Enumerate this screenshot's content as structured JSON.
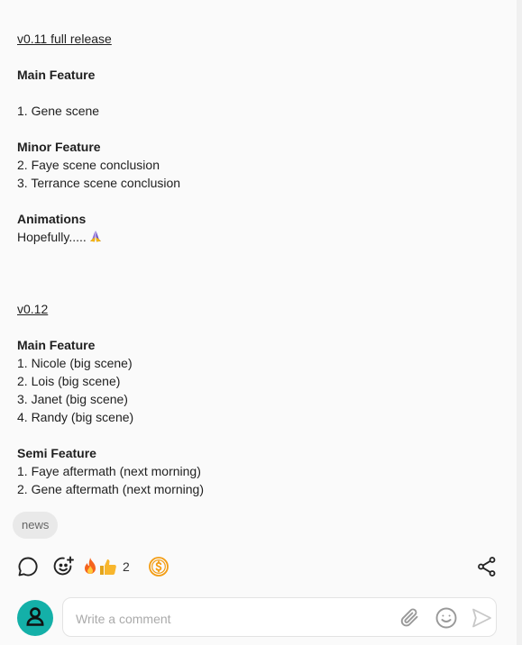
{
  "post": {
    "v011_link": "v0.11 full release",
    "v011_main_heading": "Main Feature",
    "v011_main_items": [
      "1. Gene scene"
    ],
    "v011_minor_heading": "Minor Feature",
    "v011_minor_items": [
      "2. Faye scene conclusion",
      "3. Terrance scene conclusion"
    ],
    "animations_heading": "Animations",
    "animations_text": "Hopefully.....",
    "v012_link": "v0.12",
    "v012_main_heading": "Main Feature",
    "v012_main_items": [
      "1. Nicole (big scene)",
      "2. Lois (big scene)",
      "3. Janet (big scene)",
      "4. Randy (big scene)"
    ],
    "v012_semi_heading": "Semi Feature",
    "v012_semi_items": [
      "1. Faye aftermath (next morning)",
      "2. Gene aftermath (next morning)"
    ]
  },
  "tags": [
    "news"
  ],
  "reactions": {
    "count": "2",
    "icons": [
      "comment-icon",
      "add-reaction-icon",
      "fire-emoji",
      "thumbs-up-emoji",
      "tip-coin-icon",
      "share-icon"
    ]
  },
  "comment": {
    "placeholder": "Write a comment",
    "icons": [
      "avatar-icon",
      "attachment-icon",
      "emoji-icon",
      "send-icon"
    ]
  },
  "colors": {
    "avatar_bg": "#14b0a8",
    "coin": "#f39c12",
    "fire": "#f5641e",
    "thumb": "#f8b62d"
  }
}
